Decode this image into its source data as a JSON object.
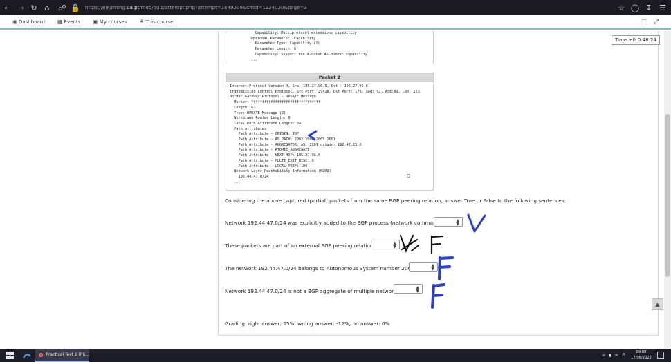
{
  "browser": {
    "url_prefix": "https://elearning.",
    "url_domain": "ua.pt",
    "url_path": "/mod/quiz/attempt.php?attempt=1649209&cmid=1124020&page=3"
  },
  "nav": {
    "dashboard": "Dashboard",
    "events": "Events",
    "my_courses": "My courses",
    "this_course": "This course"
  },
  "timer": "Time left 0:48:24",
  "packet1": {
    "lines": "      Capability: Multiprotocol extensions capability\n    Optional Parameter: Capability\n      Parameter Type: Capability (2)\n      Parameter Length: 6\n      Capability: Support for 4-octet AS number capability\n    ..."
  },
  "packet2": {
    "title": "Packet 2",
    "lines": "Internet Protocol Version 4, Src: 195.27.96.5, Dst : 195.27.96.6\nTransmission Control Protocol, Src Port: 29428, Dst Port: 179, Seq: 92, Ack:92, Len: 253\nBorder Gateway Protocol - UPDATE Message\n  Marker: ffffffffffffffffffffffffffffffff\n  Length: 61\n  Type: UPDATE Message (2)\n  Withdrawn Routes Length: 0\n  Total Path Attribute Length: 34\n  Path attributes\n    Path Attribute - ORIGIN: IGP\n    Path Attribute - AS_PATH: 2002 2004 2005 2001\n    Path Attribute - AGGREGATOR: AS: 2001 origin: 192.47.23.6\n    Path Attribute - ATOMIC_AGGREGATE\n    Path Attribute - NEXT_HOP: 195.27.96.5\n    Path Attribute - MULTI_EXIT_DISC: 0\n    Path Attribute - LOCAL_PREF: 100\n  Network Layer Reachability Information (NLRI)\n    192.44.47.0/24\n  ..."
  },
  "question": {
    "intro": "Considering the above captured (partial) packets from the same BGP peering relation, answer True or False to the following sentences:",
    "s1_pre": "Network 192.44.47.0/24 was explicitly added to the BGP process (",
    "s1_em": "network",
    "s1_post": " command).",
    "s2": "These packets are part of an external BGP peering relation.",
    "s3": "The network 192.44.47.0/24 belongs to Autonomous System number 2008.",
    "s4": "Network 192.44.47.0/24 is not a BGP aggregate of multiple networks.",
    "grading": "Grading: right answer: 25%, wrong answer: -12%, no answer: 0%"
  },
  "taskbar": {
    "task_label": "Practical Test 2 (P6...",
    "time": "09:08",
    "date": "17/06/2022"
  },
  "colors": {
    "accent_nav": "#71c7c0",
    "ink_blue": "#2a3fc4",
    "ink_black": "#111111"
  }
}
